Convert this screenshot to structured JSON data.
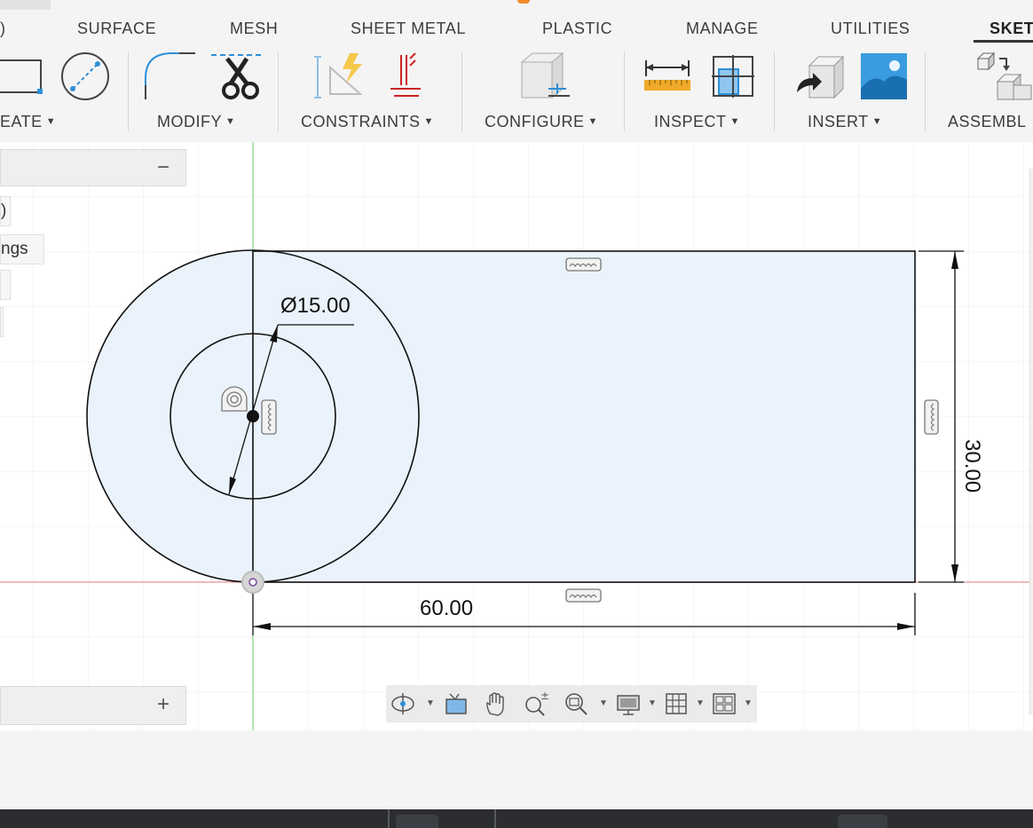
{
  "ribbon": {
    "tabs": [
      {
        "label": "SURFACE"
      },
      {
        "label": "MESH"
      },
      {
        "label": "SHEET METAL"
      },
      {
        "label": "PLASTIC"
      },
      {
        "label": "MANAGE"
      },
      {
        "label": "UTILITIES"
      },
      {
        "label": "SKET"
      }
    ],
    "groups": [
      {
        "label": "EATE"
      },
      {
        "label": "MODIFY"
      },
      {
        "label": "CONSTRAINTS"
      },
      {
        "label": "CONFIGURE"
      },
      {
        "label": "INSPECT"
      },
      {
        "label": "INSERT"
      },
      {
        "label": "ASSEMBL"
      }
    ],
    "left_cut_tab": ")"
  },
  "browser": {
    "collapse_symbol": "−",
    "row1": ")",
    "row2": "ngs"
  },
  "comments": {
    "expand_symbol": "+"
  },
  "sketch": {
    "diameter_label": "Ø15.00",
    "width_label": "60.00",
    "height_label": "30.00"
  },
  "colors": {
    "profile_fill": "#eaf3fb",
    "sketch_line": "#111111",
    "x_axis": "#e05050",
    "y_axis": "#4cc94c",
    "accent_blue": "#2d8fd8"
  }
}
